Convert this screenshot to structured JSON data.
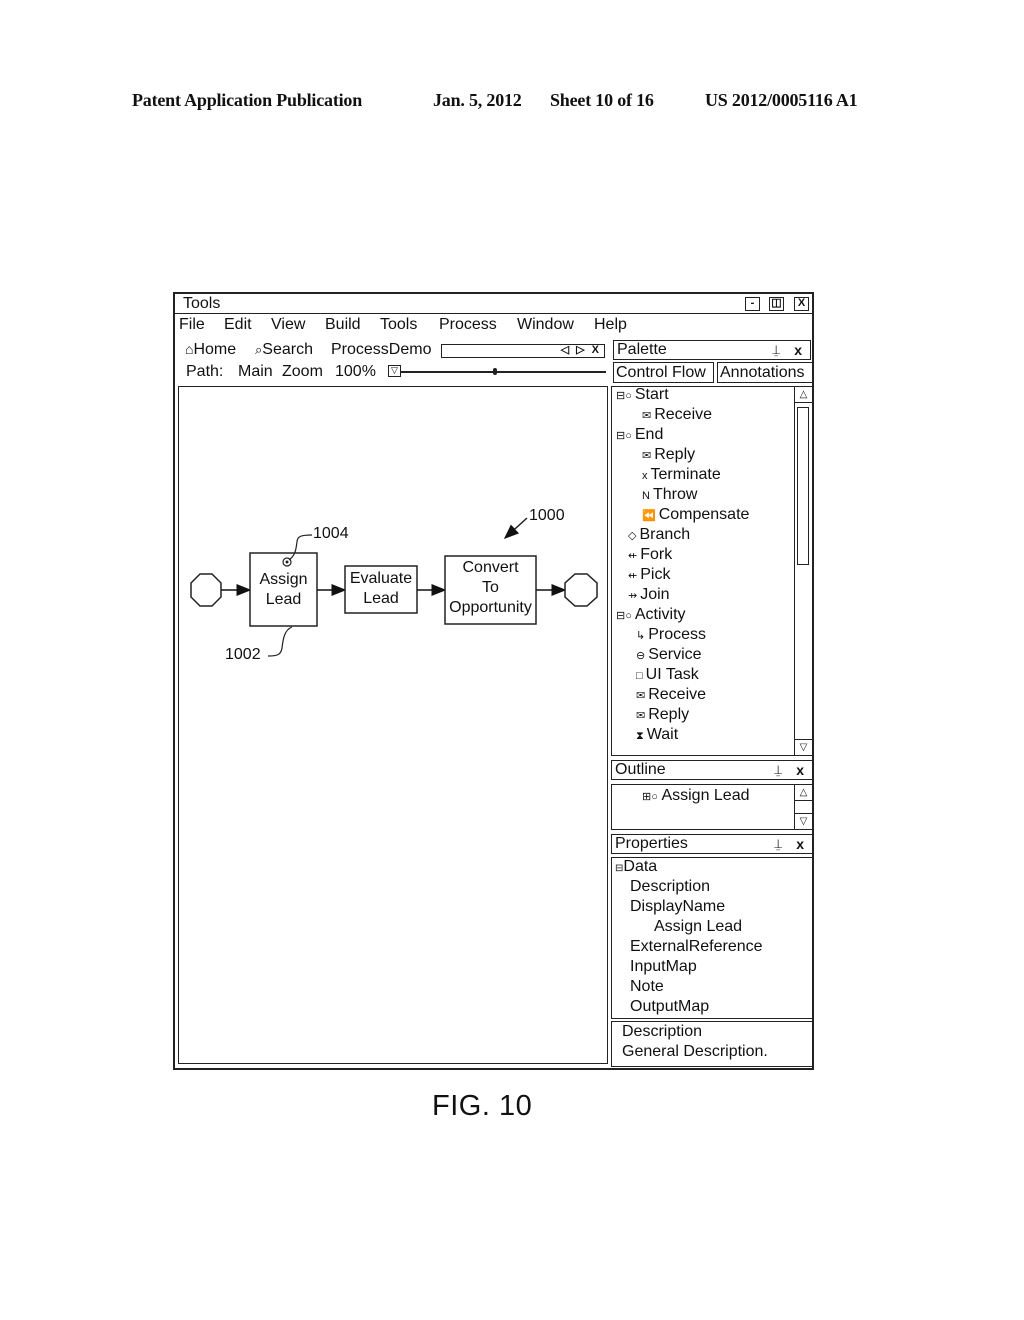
{
  "patent_header": {
    "publication": "Patent Application Publication",
    "date": "Jan. 5, 2012",
    "sheet": "Sheet 10 of 16",
    "number": "US 2012/0005116 A1"
  },
  "window": {
    "title": "Tools",
    "controls": {
      "minimize": "-",
      "restore": "◫",
      "close": "X"
    }
  },
  "menu": [
    "File",
    "Edit",
    "View",
    "Build",
    "Tools",
    "Process",
    "Window",
    "Help"
  ],
  "toolbar": {
    "home": "Home",
    "search": "Search",
    "tab_name": "ProcessDemo",
    "tab_nav": "◁ ▷ X",
    "path_label": "Path:",
    "path_value": "Main",
    "zoom_label": "Zoom",
    "zoom_value": "100%",
    "zoom_slider_fraction": 0.46
  },
  "palette": {
    "title": "Palette",
    "tabs": [
      "Control Flow",
      "Annotations"
    ],
    "items": [
      {
        "icon": "⊟○",
        "label": "Start",
        "level": 0
      },
      {
        "icon": "✉",
        "label": "Receive",
        "level": 1
      },
      {
        "icon": "⊟○",
        "label": "End",
        "level": 0
      },
      {
        "icon": "✉",
        "label": "Reply",
        "level": 1
      },
      {
        "icon": "x",
        "label": "Terminate",
        "level": 1
      },
      {
        "icon": "N",
        "label": "Throw",
        "level": 1
      },
      {
        "icon": "⏪",
        "label": "Compensate",
        "level": 1
      },
      {
        "icon": "◇",
        "label": "Branch",
        "level": 2
      },
      {
        "icon": "⇷",
        "label": "Fork",
        "level": 2
      },
      {
        "icon": "⇷",
        "label": "Pick",
        "level": 2
      },
      {
        "icon": "⇸",
        "label": "Join",
        "level": 2
      },
      {
        "icon": "⊟○",
        "label": "Activity",
        "level": 0
      },
      {
        "icon": "↳",
        "label": "Process",
        "level": 3
      },
      {
        "icon": "⊖",
        "label": "Service",
        "level": 3
      },
      {
        "icon": "□",
        "label": "UI Task",
        "level": 3
      },
      {
        "icon": "✉",
        "label": "Receive",
        "level": 3
      },
      {
        "icon": "✉",
        "label": "Reply",
        "level": 3
      },
      {
        "icon": "⧗",
        "label": "Wait",
        "level": 3
      }
    ]
  },
  "outline": {
    "title": "Outline",
    "item_icon": "⊞○",
    "item": "Assign Lead"
  },
  "properties": {
    "title": "Properties",
    "group": "Data",
    "items": [
      {
        "label": "Description",
        "level": 1
      },
      {
        "label": "DisplayName",
        "level": 1
      },
      {
        "label": "Assign Lead",
        "level": 2
      },
      {
        "label": "ExternalReference",
        "level": 1
      },
      {
        "label": "InputMap",
        "level": 1
      },
      {
        "label": "Note",
        "level": 1
      },
      {
        "label": "OutputMap",
        "level": 1
      }
    ],
    "description_title": "Description",
    "description_text": "General Description."
  },
  "diagram": {
    "nodes": [
      {
        "id": "start",
        "type": "start-octagon"
      },
      {
        "id": "assign",
        "label_lines": [
          "Assign",
          "Lead"
        ]
      },
      {
        "id": "evaluate",
        "label_lines": [
          "Evaluate",
          "Lead"
        ]
      },
      {
        "id": "convert",
        "label_lines": [
          "Convert",
          "To",
          "Opportunity"
        ]
      },
      {
        "id": "end",
        "type": "end-octagon"
      }
    ],
    "references": {
      "process": "1000",
      "activity": "1002",
      "marker": "1004"
    }
  },
  "figure_label": "FIG. 10"
}
